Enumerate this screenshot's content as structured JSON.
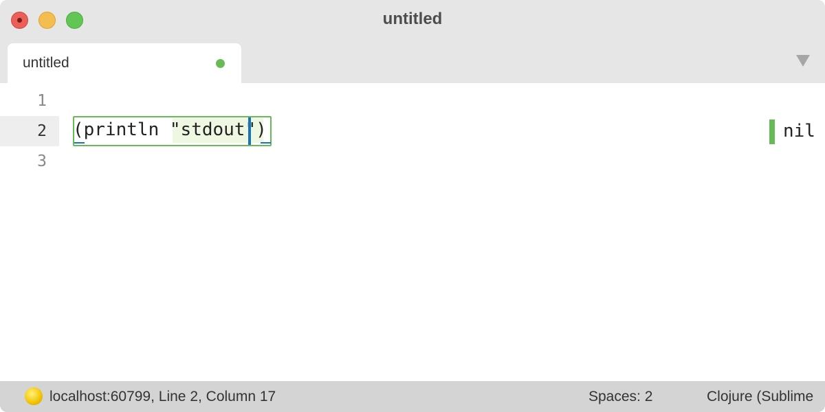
{
  "window": {
    "title": "untitled"
  },
  "tabs": [
    {
      "label": "untitled",
      "dirty": true
    }
  ],
  "editor": {
    "gutter": [
      "1",
      "2",
      "3"
    ],
    "active_line": 2,
    "code": {
      "open_paren": "(",
      "fn": "println",
      "space": " ",
      "string": "\"stdout\"",
      "close_paren": ")"
    },
    "inline_result": "nil"
  },
  "statusbar": {
    "left": "localhost:60799, Line 2, Column 17",
    "spaces": "Spaces: 2",
    "syntax": "Clojure (Sublimed)"
  },
  "colors": {
    "accent_green": "#66bb55",
    "cursor_blue": "#1a73b5",
    "close": "#ec5f58",
    "minimize": "#f4bd4f",
    "maximize": "#62c655"
  },
  "icons": {
    "status": "repl-connected-icon",
    "tab_menu": "chevron-down-icon"
  }
}
